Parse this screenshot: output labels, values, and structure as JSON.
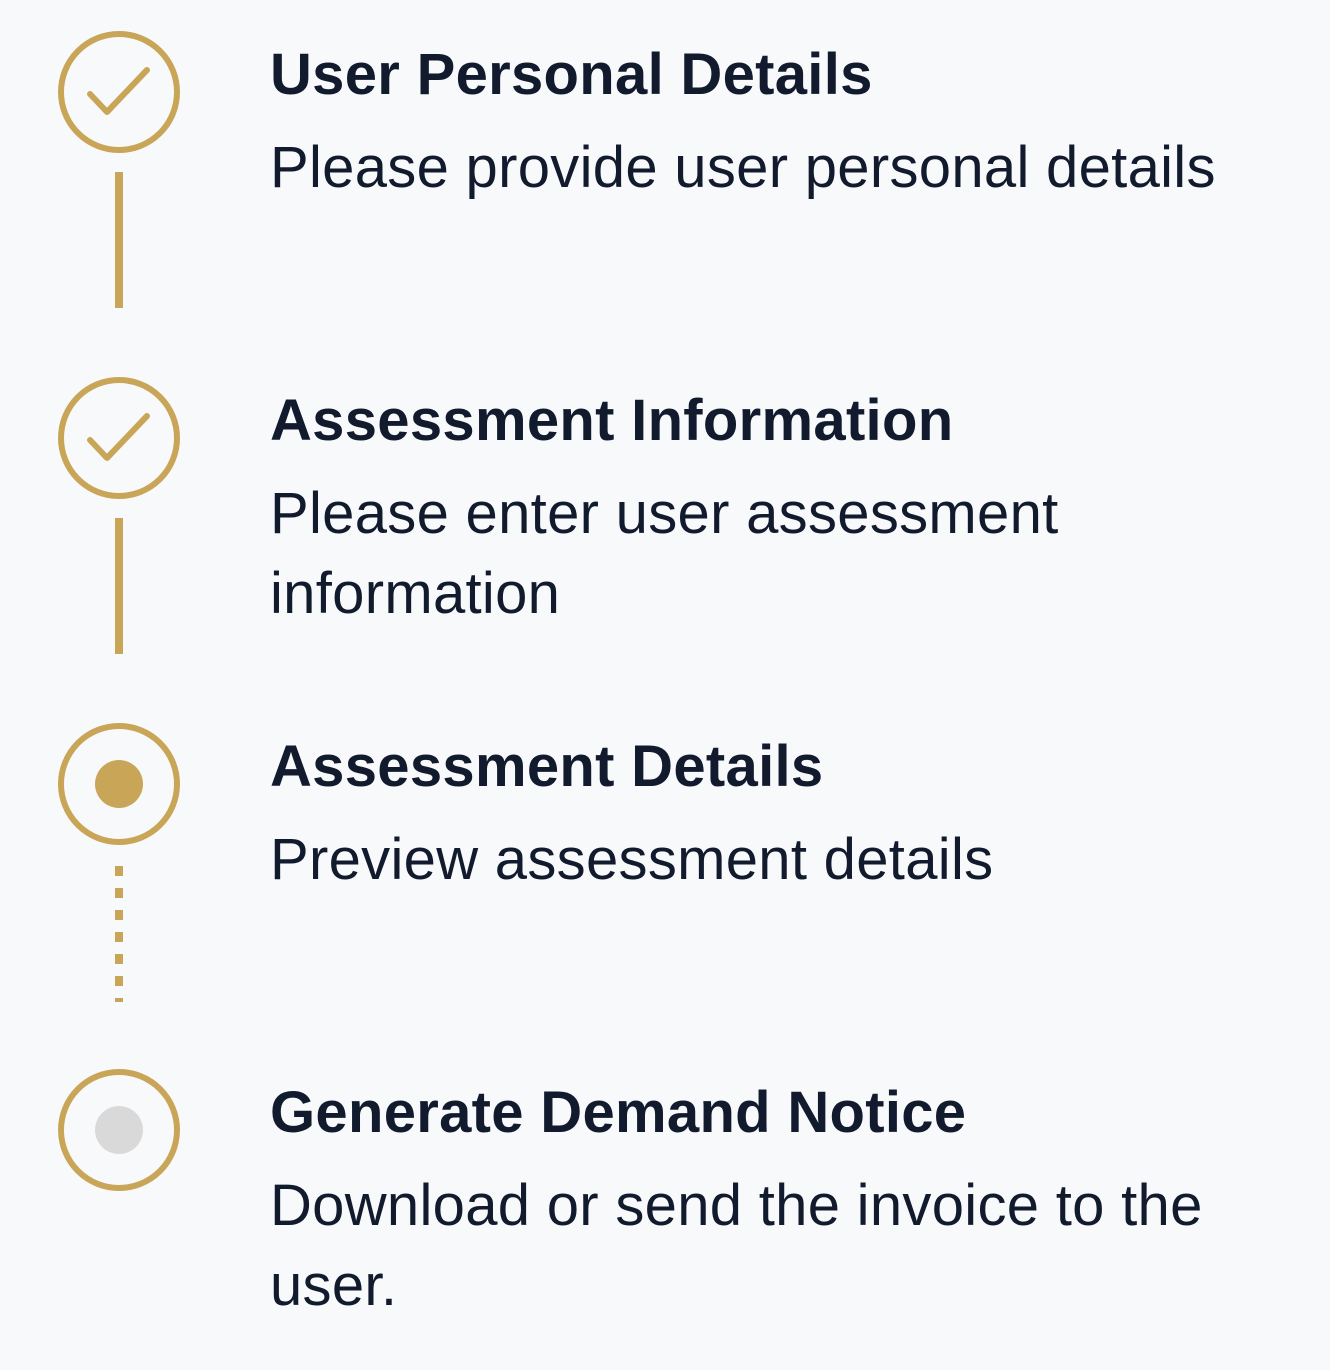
{
  "colors": {
    "accent": "#c9a558",
    "text": "#121a2e",
    "background": "#f8f9fb",
    "pending_dot": "#d9d9d9"
  },
  "steps": [
    {
      "title": "User Personal Details",
      "description": "Please provide user personal details",
      "status": "completed",
      "icon": "check-icon"
    },
    {
      "title": "Assessment Information",
      "description": "Please enter user assessment information",
      "status": "completed",
      "icon": "check-icon"
    },
    {
      "title": "Assessment Details",
      "description": "Preview assessment details",
      "status": "current",
      "icon": "active-dot-icon"
    },
    {
      "title": "Generate Demand Notice",
      "description": "Download or send the invoice to the user.",
      "status": "pending",
      "icon": "pending-dot-icon"
    }
  ]
}
